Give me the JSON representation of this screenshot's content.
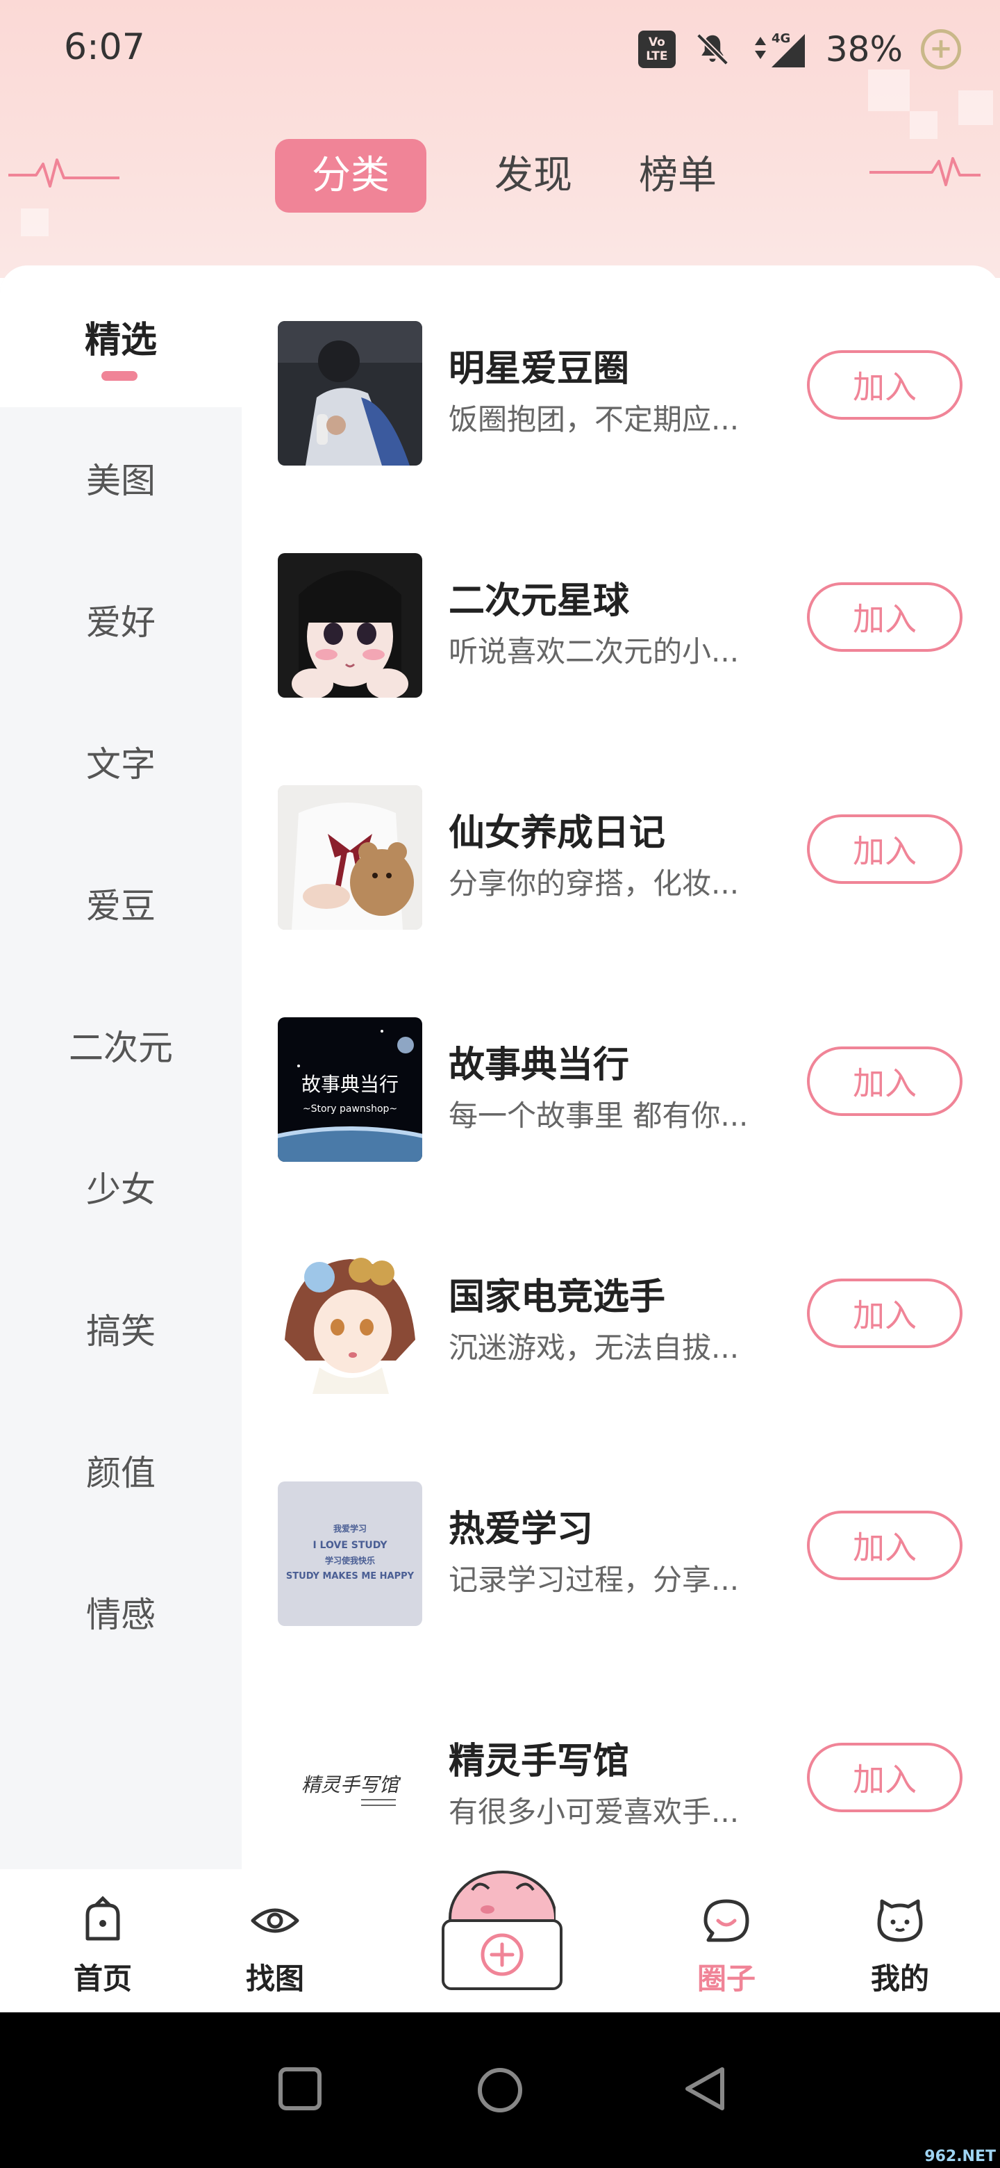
{
  "status_bar": {
    "time": "6:07",
    "volte_line1": "Vo",
    "volte_line2": "LTE",
    "network": "4G",
    "battery": "38%"
  },
  "top_tabs": [
    {
      "label": "分类",
      "active": true
    },
    {
      "label": "发现",
      "active": false
    },
    {
      "label": "榜单",
      "active": false
    }
  ],
  "sidebar": {
    "items": [
      {
        "label": "精选",
        "active": true
      },
      {
        "label": "美图"
      },
      {
        "label": "爱好"
      },
      {
        "label": "文字"
      },
      {
        "label": "爱豆"
      },
      {
        "label": "二次元"
      },
      {
        "label": "少女"
      },
      {
        "label": "搞笑"
      },
      {
        "label": "颜值"
      },
      {
        "label": "情感"
      }
    ]
  },
  "circles": {
    "join_label": "加入",
    "items": [
      {
        "title": "明星爱豆圈",
        "desc": "饭圈抱团，不定期应..."
      },
      {
        "title": "二次元星球",
        "desc": "听说喜欢二次元的小..."
      },
      {
        "title": "仙女养成日记",
        "desc": "分享你的穿搭，化妆..."
      },
      {
        "title": "故事典当行",
        "desc": "每一个故事里 都有你..."
      },
      {
        "title": "国家电竞选手",
        "desc": "沉迷游戏，无法自拔..."
      },
      {
        "title": "热爱学习",
        "desc": "记录学习过程，分享..."
      },
      {
        "title": "精灵手写馆",
        "desc": "有很多小可爱喜欢手..."
      }
    ],
    "thumb_text": {
      "story_title": "故事典当行",
      "story_sub": "~Story pawnshop~",
      "study_lines": [
        "我爱学习",
        "I LOVE STUDY",
        "学习使我快乐",
        "STUDY MAKES ME HAPPY"
      ],
      "handwriting": "精灵手写馆"
    }
  },
  "bottom_nav": {
    "items": [
      {
        "label": "首页",
        "icon": "home-icon"
      },
      {
        "label": "找图",
        "icon": "eye-icon"
      },
      {
        "label": "圈子",
        "icon": "chat-bubble-icon",
        "active": true
      },
      {
        "label": "我的",
        "icon": "cat-face-icon"
      }
    ],
    "center_icon": "add-icon"
  },
  "watermark": "962.NET",
  "colors": {
    "accent": "#f08497",
    "header_bg": "#fbe1de",
    "sidebar_bg": "#f5f6f8"
  }
}
